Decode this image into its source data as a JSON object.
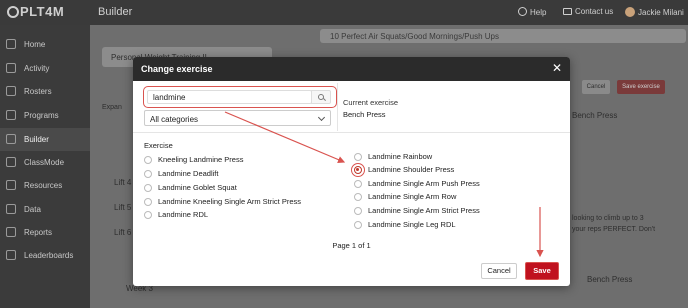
{
  "app": {
    "logo": "PLT4M",
    "title": "Builder",
    "help": "Help",
    "contact": "Contact us",
    "user": "Jackie Milani"
  },
  "sidebar": {
    "items": [
      {
        "label": "Home",
        "icon": "home-icon"
      },
      {
        "label": "Activity",
        "icon": "activity-icon"
      },
      {
        "label": "Rosters",
        "icon": "rosters-icon"
      },
      {
        "label": "Programs",
        "icon": "programs-icon"
      },
      {
        "label": "Builder",
        "icon": "builder-icon",
        "active": true
      },
      {
        "label": "ClassMode",
        "icon": "classmode-icon"
      },
      {
        "label": "Resources",
        "icon": "resources-icon"
      },
      {
        "label": "Data",
        "icon": "data-icon"
      },
      {
        "label": "Reports",
        "icon": "reports-icon"
      },
      {
        "label": "Leaderboards",
        "icon": "leaderboards-icon"
      }
    ]
  },
  "background": {
    "workout_header": "10 Perfect Air Squats/Good Mornings/Push Ups",
    "program_name": "Personal Weight Training II",
    "expand": "Expan",
    "lifts": [
      "Lift 4",
      "Lift 5",
      "Lift 6"
    ],
    "week": "Week 3",
    "cancel": "Cancel",
    "save_exercise": "Save exercise",
    "exercise_right": "Bench Press",
    "note_line1": "looking to climb up to 3",
    "note_line2": "your reps PERFECT. Don't",
    "bench_press_bottom": "Bench Press"
  },
  "modal": {
    "title": "Change exercise",
    "search_value": "landmine",
    "category": "All categories",
    "current_label": "Current exercise",
    "current_value": "Bench Press",
    "exercise_heading": "Exercise",
    "left_options": [
      "Kneeling Landmine Press",
      "Landmine Deadlift",
      "Landmine Goblet Squat",
      "Landmine Kneeling Single Arm Strict Press",
      "Landmine RDL"
    ],
    "right_options": [
      "Landmine Rainbow",
      "Landmine Shoulder Press",
      "Landmine Single Arm Push Press",
      "Landmine Single Arm Row",
      "Landmine Single Arm Strict Press",
      "Landmine Single Leg RDL"
    ],
    "selected": "Landmine Shoulder Press",
    "pager": "Page 1 of 1",
    "cancel": "Cancel",
    "save": "Save"
  },
  "colors": {
    "accent": "#c0121f",
    "annotation": "#d9534f",
    "header": "#2b2b2b"
  }
}
